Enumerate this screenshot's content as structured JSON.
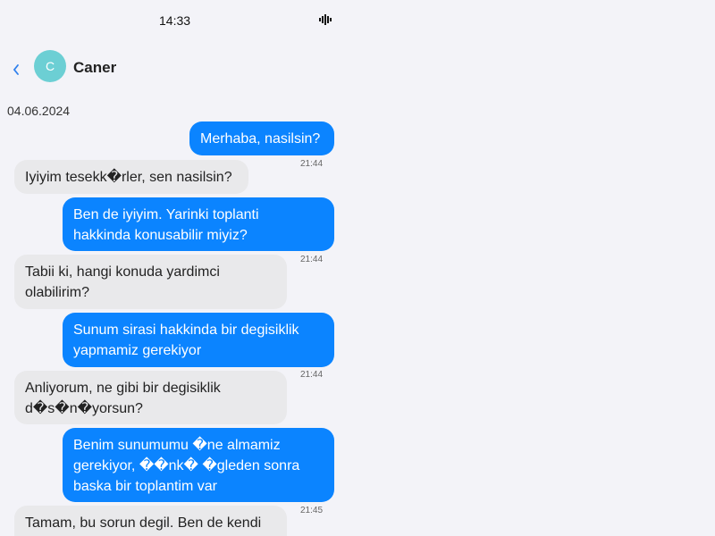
{
  "status": {
    "time": "14:33"
  },
  "header": {
    "avatar_letter": "C",
    "contact_name": "Caner"
  },
  "date": "04.06.2024",
  "messages": [
    {
      "dir": "out",
      "lines": [
        "Merhaba, nasilsin?"
      ],
      "time": "21:44"
    },
    {
      "dir": "in",
      "lines": [
        "Iyiyim tesekk�rler, sen nasilsin?"
      ]
    },
    {
      "dir": "out",
      "lines": [
        "Ben de iyiyim. Yarinki toplanti",
        "hakkinda konusabilir miyiz?"
      ],
      "time": "21:44"
    },
    {
      "dir": "in",
      "lines": [
        "Tabii ki, hangi konuda yardimci",
        "olabilirim?"
      ]
    },
    {
      "dir": "out",
      "lines": [
        "Sunum sirasi hakkinda bir degisiklik",
        "yapmamiz gerekiyor"
      ],
      "time": "21:44"
    },
    {
      "dir": "in",
      "lines": [
        "Anliyorum, ne gibi bir degisiklik",
        "d�s�n�yorsun?"
      ]
    },
    {
      "dir": "out",
      "lines": [
        "Benim sunumumu �ne almamiz",
        "gerekiyor, ��nk� �gleden sonra",
        "baska bir toplantim var"
      ],
      "time": "21:45"
    },
    {
      "dir": "in",
      "lines": [
        "Tamam, bu sorun degil. Ben de kendi"
      ]
    }
  ]
}
